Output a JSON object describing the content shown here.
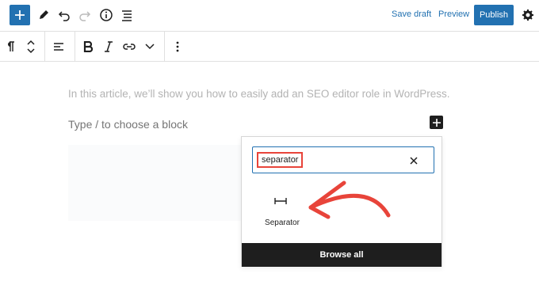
{
  "top_toolbar": {
    "save_draft_label": "Save draft",
    "preview_label": "Preview",
    "publish_label": "Publish",
    "icons": [
      "plus-icon",
      "pencil-icon",
      "undo-icon",
      "redo-icon",
      "info-icon",
      "list-view-icon",
      "gear-icon"
    ]
  },
  "block_toolbar": {
    "icons": [
      "paragraph-icon",
      "move-up-down-icon",
      "align-left-icon",
      "bold-icon",
      "italic-icon",
      "link-icon",
      "chevron-down-icon",
      "more-options-icon"
    ]
  },
  "content": {
    "paragraph": "In this article, we’ll show you how to easily add an SEO editor role in WordPress.",
    "placeholder": "Type / to choose a block"
  },
  "inserter": {
    "search_value": "separator",
    "result_label": "Separator",
    "browse_all_label": "Browse all"
  },
  "colors": {
    "accent": "#2271b1",
    "annotation": "#e8443a",
    "dark": "#1e1e1e"
  }
}
